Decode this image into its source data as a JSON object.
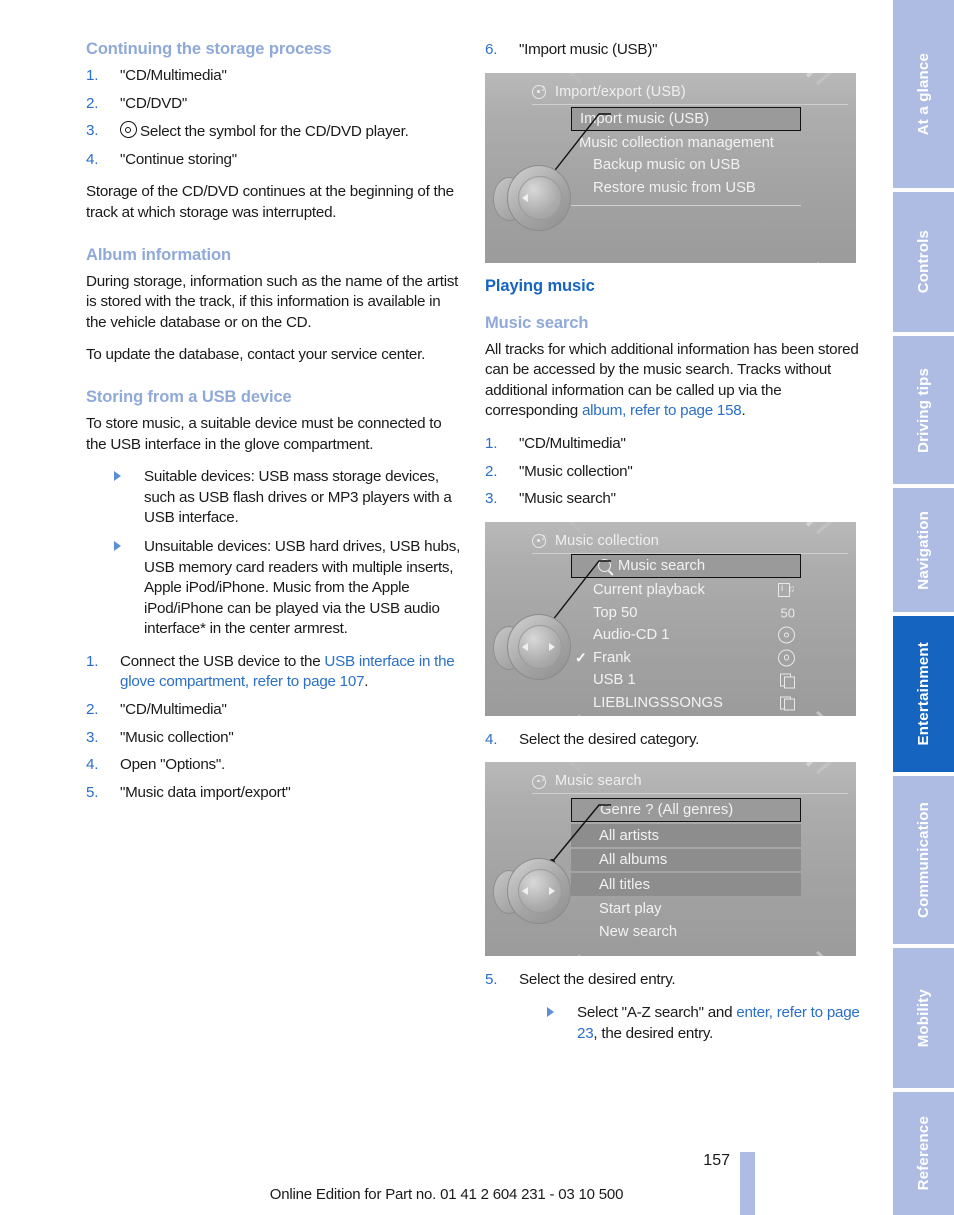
{
  "left_column": {
    "heading_storage": "Continuing the storage process",
    "steps_storage": [
      {
        "num": "1.",
        "text": "\"CD/Multimedia\""
      },
      {
        "num": "2.",
        "text": "\"CD/DVD\""
      },
      {
        "num": "3.",
        "icon": "cd-player-icon",
        "text": "Select the symbol for the CD/DVD player."
      },
      {
        "num": "4.",
        "text": "\"Continue storing\""
      }
    ],
    "paragraph_storage": "Storage of the CD/DVD continues at the beginning of the track at which storage was interrupted.",
    "heading_album": "Album information",
    "paragraph_album_1": "During storage, information such as the name of the artist is stored with the track, if this information is available in the vehicle database or on the CD.",
    "paragraph_album_2": "To update the database, contact your service center.",
    "heading_usb": "Storing from a USB device",
    "paragraph_usb": "To store music, a suitable device must be connected to the USB interface in the glove compartment.",
    "bullets_usb": [
      "Suitable devices: USB mass storage devices, such as USB flash drives or MP3 players with a USB interface.",
      "Unsuitable devices: USB hard drives, USB hubs, USB memory card readers with multiple inserts, Apple iPod/iPhone. Music from the Apple iPod/iPhone can be played via the USB audio interface* in the center armrest."
    ],
    "steps_usb": [
      {
        "num": "1.",
        "text_pre": "Connect the USB device to the ",
        "link": "USB interface in the glove compartment, refer to page 107",
        "text_post": "."
      },
      {
        "num": "2.",
        "text": "\"CD/Multimedia\""
      },
      {
        "num": "3.",
        "text": "\"Music collection\""
      },
      {
        "num": "4.",
        "text": "Open \"Options\"."
      },
      {
        "num": "5.",
        "text": "\"Music data import/export\""
      }
    ]
  },
  "right_column": {
    "step6": {
      "num": "6.",
      "text": "\"Import music (USB)\""
    },
    "screenshot_import": {
      "title": "Import/export (USB)",
      "icon": "cd-note-icon",
      "items": [
        {
          "label": "Import music (USB)",
          "style": "selected",
          "indent": 0
        },
        {
          "label": "Music collection management",
          "style": "plain",
          "indent": 0
        },
        {
          "label": "Backup music on USB",
          "style": "plain",
          "indent": 1
        },
        {
          "label": "Restore music from USB",
          "style": "plain",
          "indent": 1
        }
      ]
    },
    "heading_playing": "Playing music",
    "heading_search": "Music search",
    "paragraph_search_pre": "All tracks for which additional information has been stored can be accessed by the music search. Tracks without additional information can be called up via the corresponding ",
    "paragraph_search_link": "album, refer to page 158",
    "paragraph_search_post": ".",
    "steps_search": [
      {
        "num": "1.",
        "text": "\"CD/Multimedia\""
      },
      {
        "num": "2.",
        "text": "\"Music collection\""
      },
      {
        "num": "3.",
        "text": "\"Music search\""
      }
    ],
    "screenshot_collection": {
      "title": "Music collection",
      "icon": "cd-note-icon",
      "items": [
        {
          "label": "Music search",
          "style": "selected",
          "left_icon": "search-icon",
          "right_icon": ""
        },
        {
          "label": "Current playback",
          "style": "plain",
          "right_icon": "info-note-icon"
        },
        {
          "label": "Top 50",
          "style": "plain",
          "right_icon": "50"
        },
        {
          "label": "Audio-CD 1",
          "style": "plain",
          "right_icon": "disc-icon"
        },
        {
          "label": "Frank",
          "style": "plain",
          "checked": true,
          "right_icon": "disc-icon"
        },
        {
          "label": "USB 1",
          "style": "plain",
          "right_icon": "folder-icon"
        },
        {
          "label": "LIEBLINGSSONGS",
          "style": "plain",
          "right_icon": "folder-icon"
        }
      ]
    },
    "step4": {
      "num": "4.",
      "text": "Select the desired category."
    },
    "screenshot_musicsearch": {
      "title": "Music search",
      "icon": "cd-note-icon",
      "items": [
        {
          "label": "Genre ? (All genres)",
          "style": "selected"
        },
        {
          "label": "All artists",
          "style": "band"
        },
        {
          "label": "All albums",
          "style": "band"
        },
        {
          "label": "All titles",
          "style": "band"
        },
        {
          "label": "Start play",
          "style": "plain"
        },
        {
          "label": "New search",
          "style": "plain"
        }
      ]
    },
    "step5": {
      "num": "5.",
      "text": "Select the desired entry."
    },
    "bullet5_pre": "Select \"A-Z search\" and ",
    "bullet5_link": "enter, refer to page 23",
    "bullet5_post": ", the desired entry."
  },
  "rail": {
    "tabs": [
      {
        "label": "At a glance",
        "active": false
      },
      {
        "label": "Controls",
        "active": false
      },
      {
        "label": "Driving tips",
        "active": false
      },
      {
        "label": "Navigation",
        "active": false
      },
      {
        "label": "Entertainment",
        "active": true
      },
      {
        "label": "Communication",
        "active": false
      },
      {
        "label": "Mobility",
        "active": false
      },
      {
        "label": "Reference",
        "active": false
      }
    ]
  },
  "footer": {
    "page_number": "157",
    "text": "Online Edition for Part no. 01 41 2 604 231 - 03 10 500"
  },
  "colors": {
    "heading_light_blue": "#8fa9d9",
    "heading_blue": "#1565c0",
    "link_blue": "#2a6fc9",
    "tab_blue": "#aebce4",
    "tab_active": "#1565c0"
  }
}
